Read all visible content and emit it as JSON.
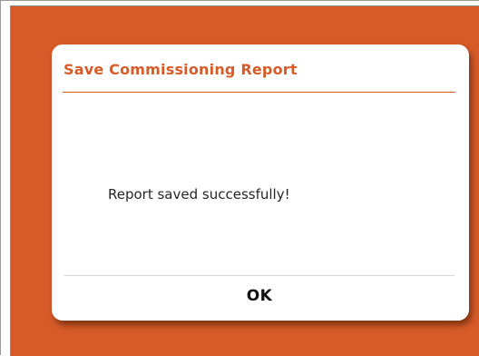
{
  "dialog": {
    "title": "Save Commissioning Report",
    "message": "Report saved successfully!",
    "ok_label": "OK"
  },
  "colors": {
    "accent": "#d75b28",
    "dialog_background": "#ffffff",
    "message_text": "#262626"
  }
}
